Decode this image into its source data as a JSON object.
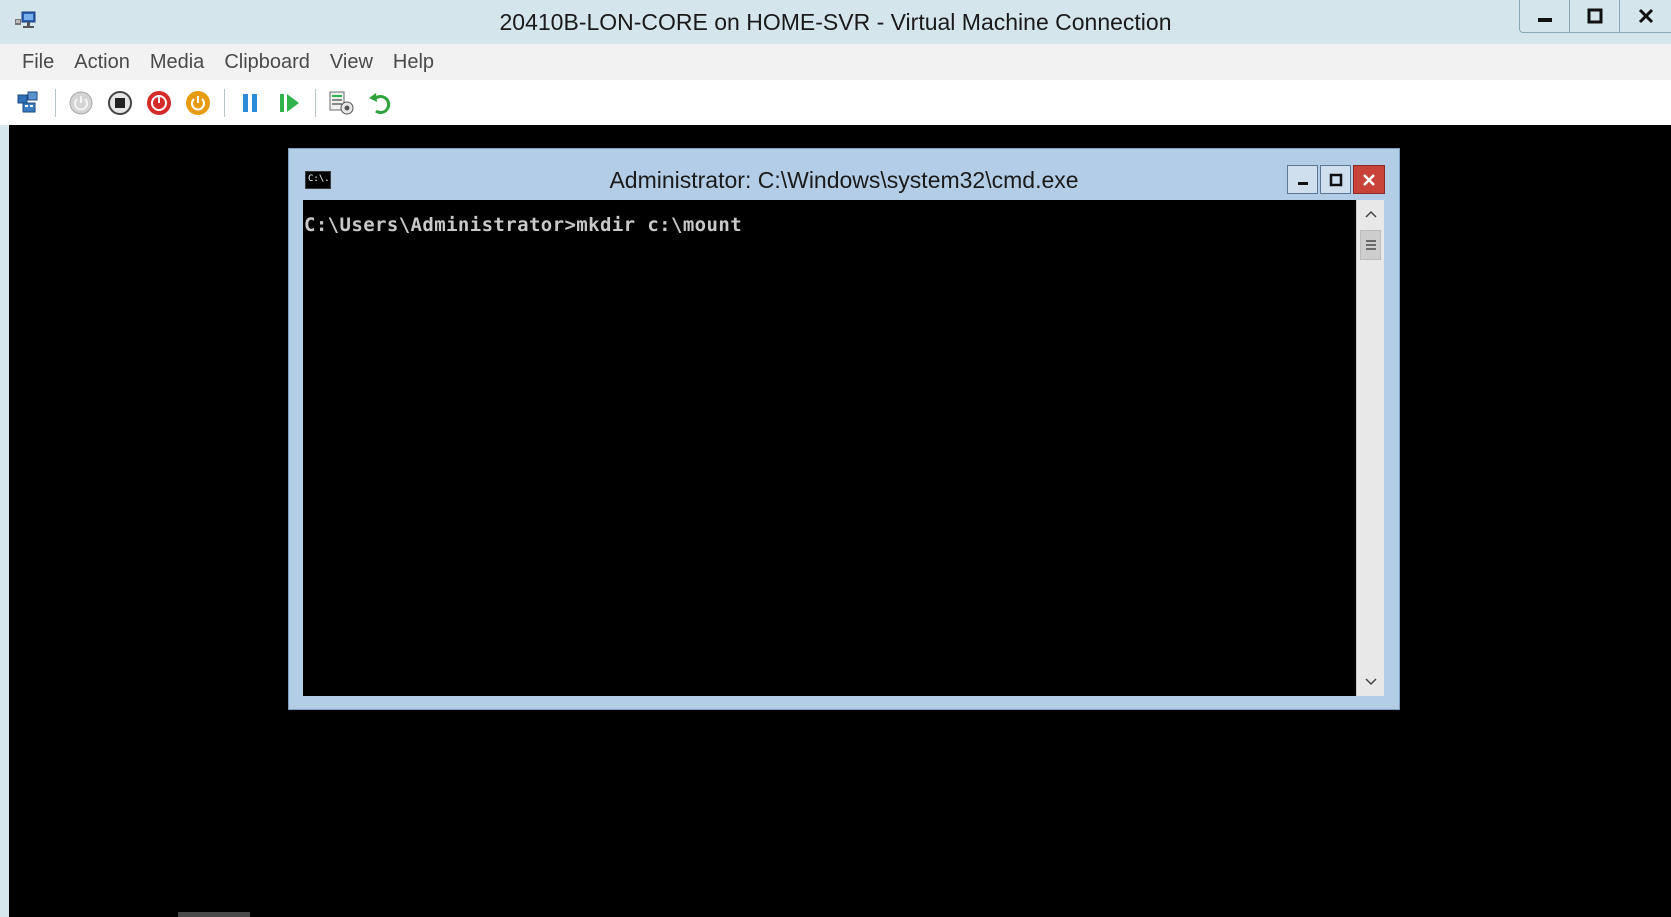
{
  "window": {
    "title": "20410B-LON-CORE on HOME-SVR - Virtual Machine Connection",
    "icon": "vm-connection-icon",
    "controls": [
      "minimize-icon",
      "maximize-icon",
      "close-icon"
    ]
  },
  "menu": {
    "items": [
      {
        "label": "File"
      },
      {
        "label": "Action"
      },
      {
        "label": "Media"
      },
      {
        "label": "Clipboard"
      },
      {
        "label": "View"
      },
      {
        "label": "Help"
      }
    ]
  },
  "toolbar": {
    "buttons": [
      {
        "icon": "ctrl-alt-del-icon"
      },
      {
        "icon": "start-icon",
        "state": "disabled"
      },
      {
        "icon": "turn-off-icon"
      },
      {
        "icon": "shut-down-icon"
      },
      {
        "icon": "save-icon"
      },
      {
        "icon": "pause-icon"
      },
      {
        "icon": "reset-icon"
      },
      {
        "icon": "checkpoint-icon"
      },
      {
        "icon": "revert-icon"
      }
    ]
  },
  "cmd": {
    "title": "Administrator: C:\\Windows\\system32\\cmd.exe",
    "icon_text": "C:\\.",
    "line1": "C:\\Users\\Administrator>mkdir c:\\mount"
  },
  "colors": {
    "chrome": "#d7e7ee",
    "screen": "#000000",
    "cmd_frame": "#b4cde6",
    "close_red": "#c9433a"
  }
}
